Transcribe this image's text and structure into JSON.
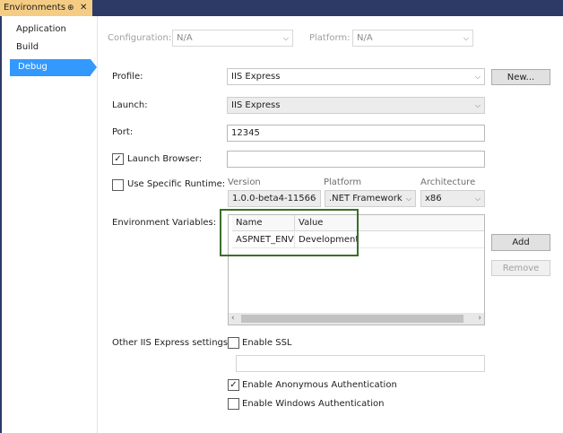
{
  "tab": {
    "title": "Environments",
    "pin_glyph": "⊕",
    "close_glyph": "✕"
  },
  "sidebar": {
    "items": [
      {
        "label": "Application"
      },
      {
        "label": "Build"
      },
      {
        "label": "Debug",
        "active": true
      }
    ]
  },
  "config_bar": {
    "configuration_label": "Configuration:",
    "configuration_value": "N/A",
    "platform_label": "Platform:",
    "platform_value": "N/A"
  },
  "form": {
    "profile_label": "Profile:",
    "profile_value": "IIS Express",
    "new_button": "New...",
    "launch_label": "Launch:",
    "launch_value": "IIS Express",
    "port_label": "Port:",
    "port_value": "12345",
    "launch_browser_label": "Launch Browser:",
    "launch_browser_checked": "✓",
    "launch_browser_value": "",
    "specific_runtime_label": "Use Specific Runtime:",
    "version_header": "Version",
    "platform_header": "Platform",
    "architecture_header": "Architecture",
    "version_value": "1.0.0-beta4-11566",
    "platform_value": ".NET Framework",
    "architecture_value": "x86",
    "env_vars_label": "Environment Variables:",
    "env_columns": [
      "Name",
      "Value"
    ],
    "env_rows": [
      {
        "name": "ASPNET_ENV",
        "value": "Development"
      }
    ],
    "add_button": "Add",
    "remove_button": "Remove",
    "iis_settings_label": "Other IIS Express settings:",
    "enable_ssl_label": "Enable SSL",
    "ssl_url_value": "",
    "anon_auth_label": "Enable Anonymous Authentication",
    "anon_auth_checked": "✓",
    "windows_auth_label": "Enable Windows Authentication"
  },
  "colors": {
    "accent": "#3399ff",
    "tab": "#f5cc84",
    "titlebar": "#2d3a66",
    "highlight_border": "#3b6e2a"
  }
}
